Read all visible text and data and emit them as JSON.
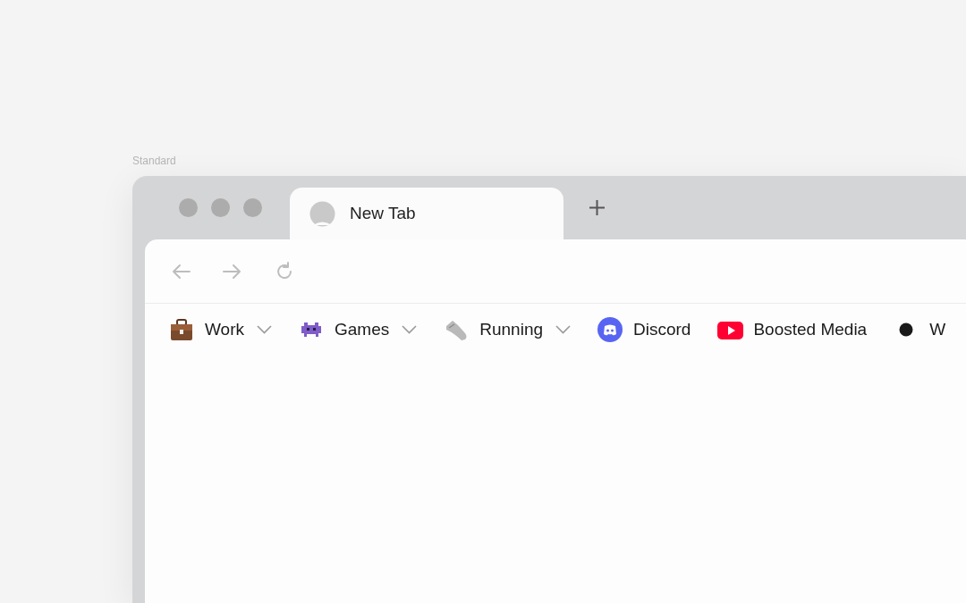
{
  "window_label": "Standard",
  "tabs": [
    {
      "title": "New Tab",
      "selected": true
    }
  ],
  "bookmarks": [
    {
      "kind": "folder",
      "label": "Work"
    },
    {
      "kind": "folder",
      "label": "Games"
    },
    {
      "kind": "folder",
      "label": "Running"
    },
    {
      "kind": "link",
      "label": "Discord"
    },
    {
      "kind": "link",
      "label": "Boosted Media"
    },
    {
      "kind": "link",
      "label": "W"
    }
  ]
}
